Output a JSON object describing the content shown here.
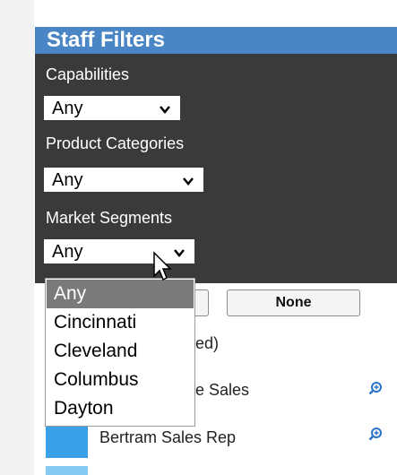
{
  "panel": {
    "title": "Staff Filters"
  },
  "filters": [
    {
      "label": "Capabilities",
      "value": "Any"
    },
    {
      "label": "Product Categories",
      "value": "Any"
    },
    {
      "label": "Market Segments",
      "value": "Any"
    }
  ],
  "buttons": {
    "all_label": "",
    "none_label": "None"
  },
  "dropdown": {
    "options": [
      "Any",
      "Cincinnati",
      "Cleveland",
      "Columbus",
      "Dayton"
    ],
    "selected": "Any"
  },
  "list": {
    "status_fragment": "ed)",
    "rows": [
      {
        "name_fragment": "e Sales",
        "color": "#3aa0e8"
      },
      {
        "name": "Bertram Sales Rep",
        "color": "#3aa0e8"
      },
      {
        "name": "",
        "color": "#86c9f2"
      }
    ]
  },
  "colors": {
    "header": "#4a86c5",
    "filter_bg": "#3a3a3a",
    "selected_option": "#7a7a7a"
  },
  "icons": [
    "chevron-down-icon",
    "zoom-icon",
    "mouse-cursor-icon"
  ]
}
